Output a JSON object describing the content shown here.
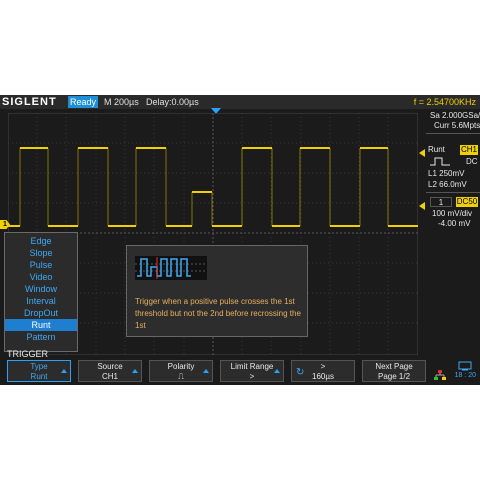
{
  "topbar": {
    "brand": "SIGLENT",
    "status": "Ready",
    "timebase": "M 200µs",
    "delay": "Delay:0.00µs",
    "frequency": "f = 2.54700KHz"
  },
  "right_panel": {
    "sample_rate": "Sa 2.000GSa/s",
    "memory": "Curr 5.6Mpts",
    "trigger_type": "Runt",
    "channel": "CH1",
    "coupling": "DC",
    "level1": "L1  250mV",
    "level2": "L2  66.0mV",
    "channel_number": "1",
    "impedance": "DC50",
    "scale": "100 mV/div",
    "offset": "-4.00 mV"
  },
  "channel_marker": "1",
  "type_menu": {
    "items": [
      "Edge",
      "Slope",
      "Pulse",
      "Video",
      "Window",
      "Interval",
      "DropOut",
      "Runt",
      "Pattern"
    ],
    "selected": "Runt"
  },
  "help": {
    "text": "Trigger when a positive pulse crosses the 1st threshold but not the 2nd before recrossing the 1st"
  },
  "menu": {
    "title": "TRIGGER",
    "softkeys": [
      {
        "line1": "Type",
        "line2": "Runt"
      },
      {
        "line1": "Source",
        "line2": "CH1"
      },
      {
        "line1": "Polarity",
        "line2": "⎍"
      },
      {
        "line1": "Limit Range",
        "line2": ">"
      },
      {
        "line1": ">",
        "line2": "160µs"
      },
      {
        "line1": "Next Page",
        "line2": "Page 1/2"
      }
    ]
  },
  "clock": "18 : 20",
  "colors": {
    "trace": "#f0d000",
    "accent": "#2aa0ff",
    "background": "#1b1b1b"
  }
}
